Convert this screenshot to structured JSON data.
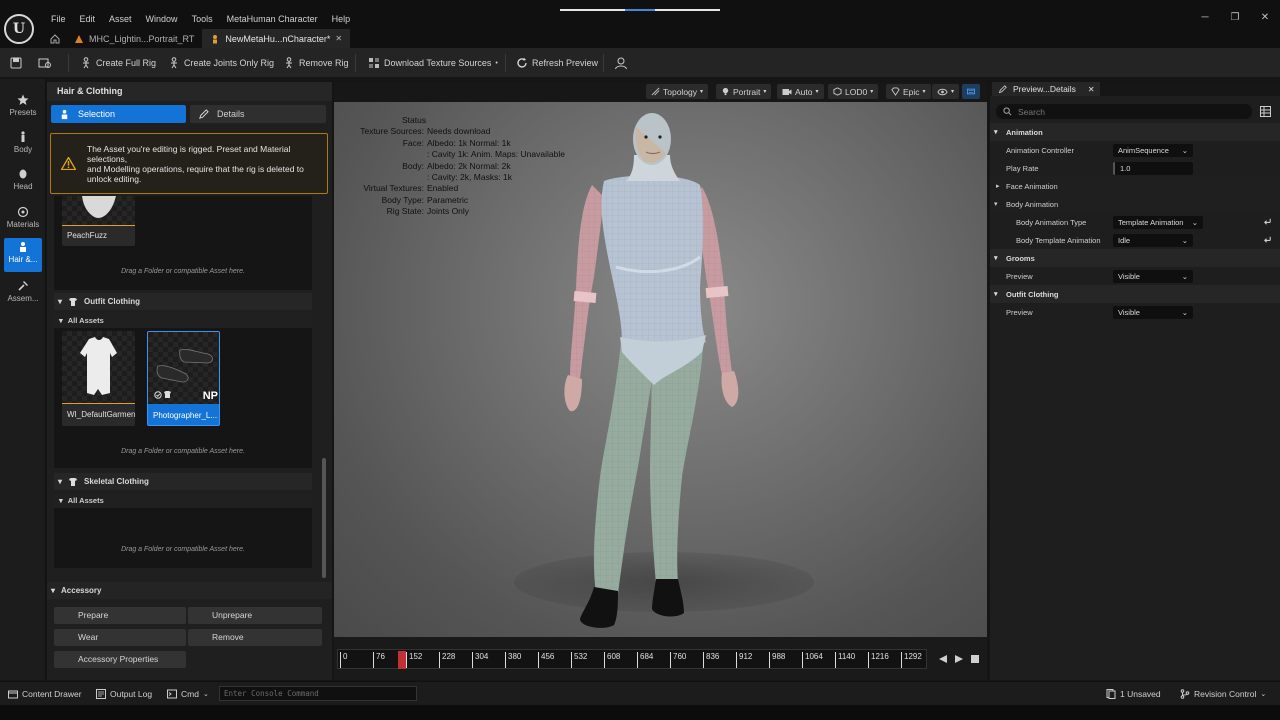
{
  "menu": [
    "File",
    "Edit",
    "Asset",
    "Window",
    "Tools",
    "MetaHuman Character",
    "Help"
  ],
  "tabs": [
    {
      "label": "MHC_Lightin...Portrait_RT"
    },
    {
      "label": "NewMetaHu...nCharacter*"
    }
  ],
  "toolbar": {
    "create_full_rig": "Create Full Rig",
    "create_joints_rig": "Create Joints Only Rig",
    "remove_rig": "Remove Rig",
    "download_textures": "Download Texture Sources",
    "refresh_preview": "Refresh Preview"
  },
  "leftnav": [
    {
      "label": "Presets",
      "icon": "star-icon"
    },
    {
      "label": "Body",
      "icon": "body-icon"
    },
    {
      "label": "Head",
      "icon": "head-icon"
    },
    {
      "label": "Materials",
      "icon": "materials-icon"
    },
    {
      "label": "Hair &...",
      "icon": "hair-icon"
    },
    {
      "label": "Assem...",
      "icon": "hammer-icon"
    }
  ],
  "leftpanel": {
    "title": "Hair & Clothing",
    "tab_selection": "Selection",
    "tab_details": "Details",
    "warning": "The Asset you're editing is rigged. Preset and Material selections,\nand Modelling operations, require that the rig is deleted to unlock editing.",
    "peachfuzz_label": "PeachFuzz",
    "drop_hint": "Drag a Folder or compatible Asset here.",
    "outfit_section": "Outfit Clothing",
    "all_assets": "All Assets",
    "outfit_items": [
      "WI_DefaultGarment",
      "Photographer_L..."
    ],
    "np_badge": "NP",
    "skeletal_section": "Skeletal Clothing",
    "accessory_section": "Accessory",
    "accessory_buttons": {
      "prepare": "Prepare",
      "unprepare": "Unprepare",
      "wear": "Wear",
      "remove": "Remove",
      "properties": "Accessory Properties"
    }
  },
  "viewport": {
    "topbar": {
      "topology": "Topology",
      "portrait": "Portrait",
      "auto": "Auto",
      "lod": "LOD0",
      "quality": "Epic"
    },
    "status": {
      "title": "Status",
      "rows": [
        {
          "k": "Texture Sources:",
          "v": "Needs download"
        },
        {
          "k": "Face:",
          "v": "Albedo: 1k Normal: 1k"
        },
        {
          "k": "",
          "v": ": Cavity 1k: Anim. Maps: Unavailable"
        },
        {
          "k": "Body:",
          "v": "Albedo: 2k Normal: 2k"
        },
        {
          "k": "",
          "v": ": Cavity: 2k, Masks: 1k"
        },
        {
          "k": "Virtual Textures:",
          "v": "Enabled"
        },
        {
          "k": "Body Type:",
          "v": "Parametric"
        },
        {
          "k": "Rig State:",
          "v": "Joints Only"
        }
      ]
    }
  },
  "timeline": {
    "ticks": [
      "0",
      "76",
      "152",
      "228",
      "304",
      "380",
      "456",
      "532",
      "608",
      "684",
      "760",
      "836",
      "912",
      "988",
      "1064",
      "1140",
      "1216",
      "1292"
    ],
    "playhead_frame": 152
  },
  "details": {
    "tab": "Preview...Details",
    "search_placeholder": "Search",
    "rows": {
      "animation": "Animation",
      "anim_controller": "Animation Controller",
      "anim_controller_val": "AnimSequence",
      "play_rate": "Play Rate",
      "play_rate_val": "1.0",
      "face_animation": "Face Animation",
      "body_animation": "Body Animation",
      "body_anim_type": "Body Animation Type",
      "body_anim_type_val": "Template Animation",
      "body_template_anim": "Body Template Animation",
      "body_template_anim_val": "Idle",
      "grooms": "Grooms",
      "grooms_preview": "Preview",
      "grooms_preview_val": "Visible",
      "outfit": "Outfit Clothing",
      "outfit_preview": "Preview",
      "outfit_preview_val": "Visible"
    }
  },
  "statusbar": {
    "content_drawer": "Content Drawer",
    "output_log": "Output Log",
    "cmd": "Cmd",
    "console_placeholder": "Enter Console Command",
    "unsaved": "1 Unsaved",
    "revision": "Revision Control"
  },
  "colors": {
    "accent": "#1473d6",
    "warning": "#b07a10",
    "playhead": "#c03035"
  }
}
